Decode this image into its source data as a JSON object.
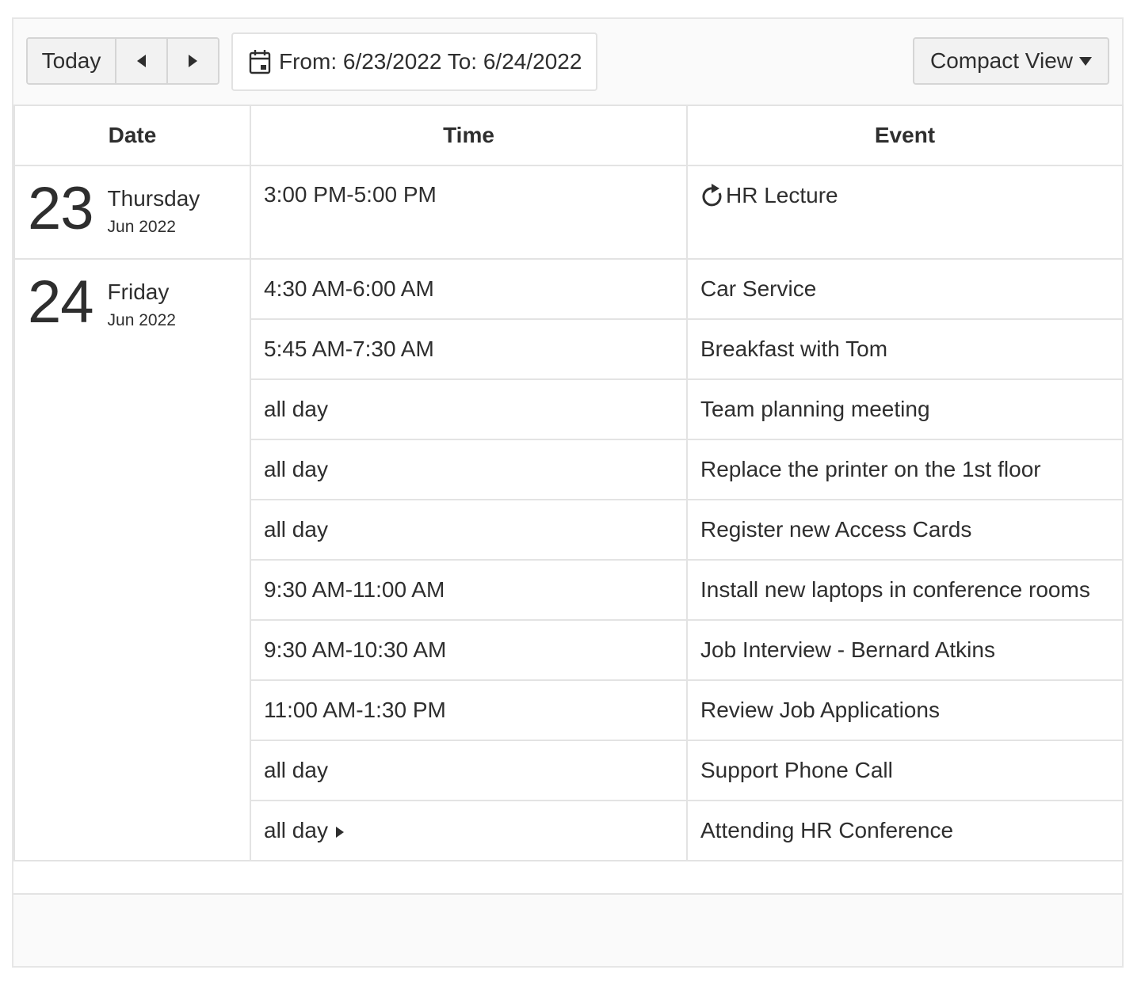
{
  "toolbar": {
    "today_label": "Today",
    "date_range_label": "From: 6/23/2022 To: 6/24/2022",
    "view_label": "Compact View"
  },
  "columns": {
    "date": "Date",
    "time": "Time",
    "event": "Event"
  },
  "days": [
    {
      "day_number": "23",
      "day_name": "Thursday",
      "month_year": "Jun 2022",
      "events": [
        {
          "time": "3:00 PM-5:00 PM",
          "title": "HR Lecture",
          "recurring": true
        }
      ]
    },
    {
      "day_number": "24",
      "day_name": "Friday",
      "month_year": "Jun 2022",
      "events": [
        {
          "time": "4:30 AM-6:00 AM",
          "title": "Car Service"
        },
        {
          "time": "5:45 AM-7:30 AM",
          "title": "Breakfast with Tom"
        },
        {
          "time": "all day",
          "title": "Team planning meeting"
        },
        {
          "time": "all day",
          "title": "Replace the printer on the 1st floor"
        },
        {
          "time": "all day",
          "title": "Register new Access Cards"
        },
        {
          "time": "9:30 AM-11:00 AM",
          "title": "Install new laptops in conference rooms"
        },
        {
          "time": "9:30 AM-10:30 AM",
          "title": "Job Interview - Bernard Atkins"
        },
        {
          "time": "11:00 AM-1:30 PM",
          "title": "Review Job Applications"
        },
        {
          "time": "all day",
          "title": "Support Phone Call"
        },
        {
          "time": "all day",
          "title": "Attending HR Conference",
          "continues": true
        }
      ]
    }
  ]
}
